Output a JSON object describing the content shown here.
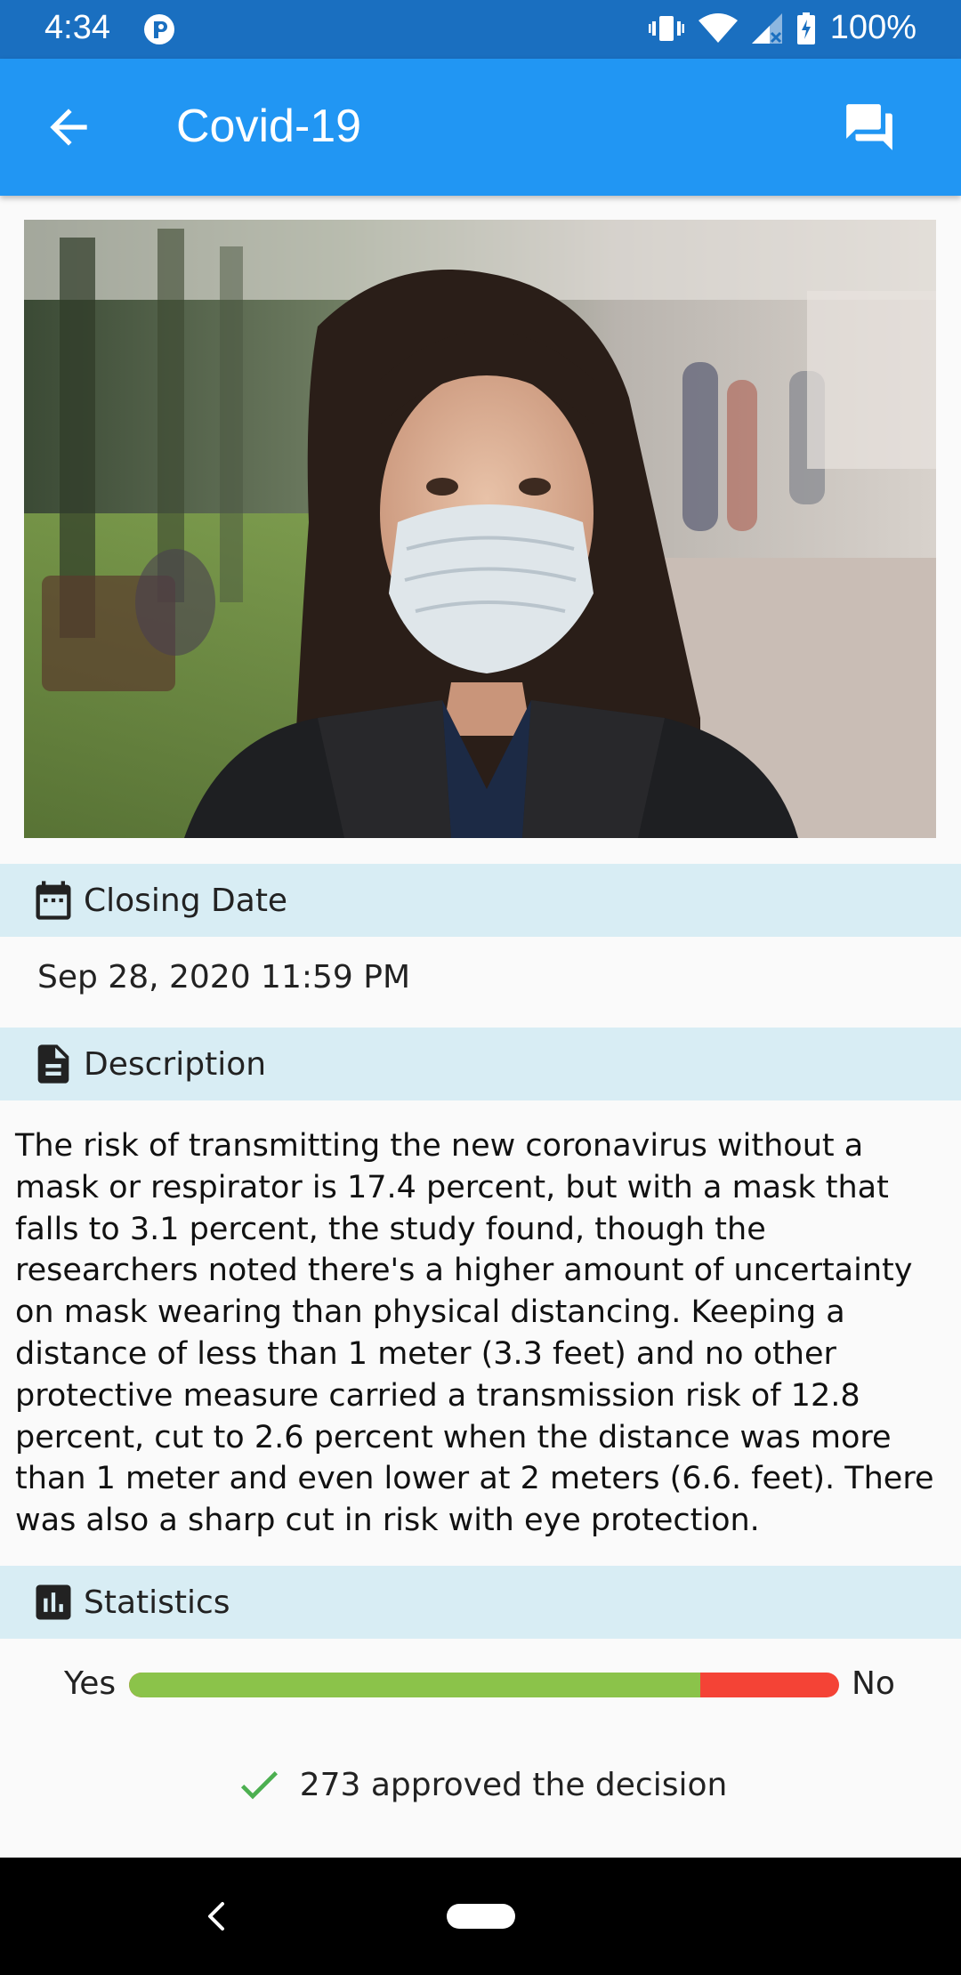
{
  "status_bar": {
    "time": "4:34",
    "battery": "100%"
  },
  "app_bar": {
    "title": "Covid-19"
  },
  "sections": {
    "closing_date": {
      "title": "Closing Date",
      "value": "Sep 28, 2020 11:59 PM"
    },
    "description": {
      "title": "Description",
      "text": "The risk of transmitting the new coronavirus without a mask or respirator is 17.4 percent, but with a mask that falls to 3.1 percent,  the study found, though the researchers  noted there's a higher amount of uncertainty on mask wearing than physical distancing. Keeping a distance of less than 1 meter (3.3 feet)  and no other protective measure carried a transmission risk of 12.8 percent, cut to 2.6 percent when the distance was more than 1 meter and even lower at  2 meters (6.6. feet). There was also a sharp cut in risk with eye protection."
    },
    "statistics": {
      "title": "Statistics",
      "yes_label": "Yes",
      "no_label": "No",
      "yes_fraction": 0.805,
      "yes_color": "#8bc34a",
      "no_color": "#f44336",
      "approved_text": "273 approved the decision"
    }
  },
  "colors": {
    "status_bar": "#1a6fc0",
    "app_bar": "#2196f3",
    "section_header": "#d8edf4",
    "check": "#4caf50"
  },
  "icons": {
    "back": "arrow-left-icon",
    "chat": "forum-icon",
    "closing_date": "calendar-icon",
    "description": "document-icon",
    "statistics": "bar-chart-icon",
    "approved": "check-icon"
  }
}
